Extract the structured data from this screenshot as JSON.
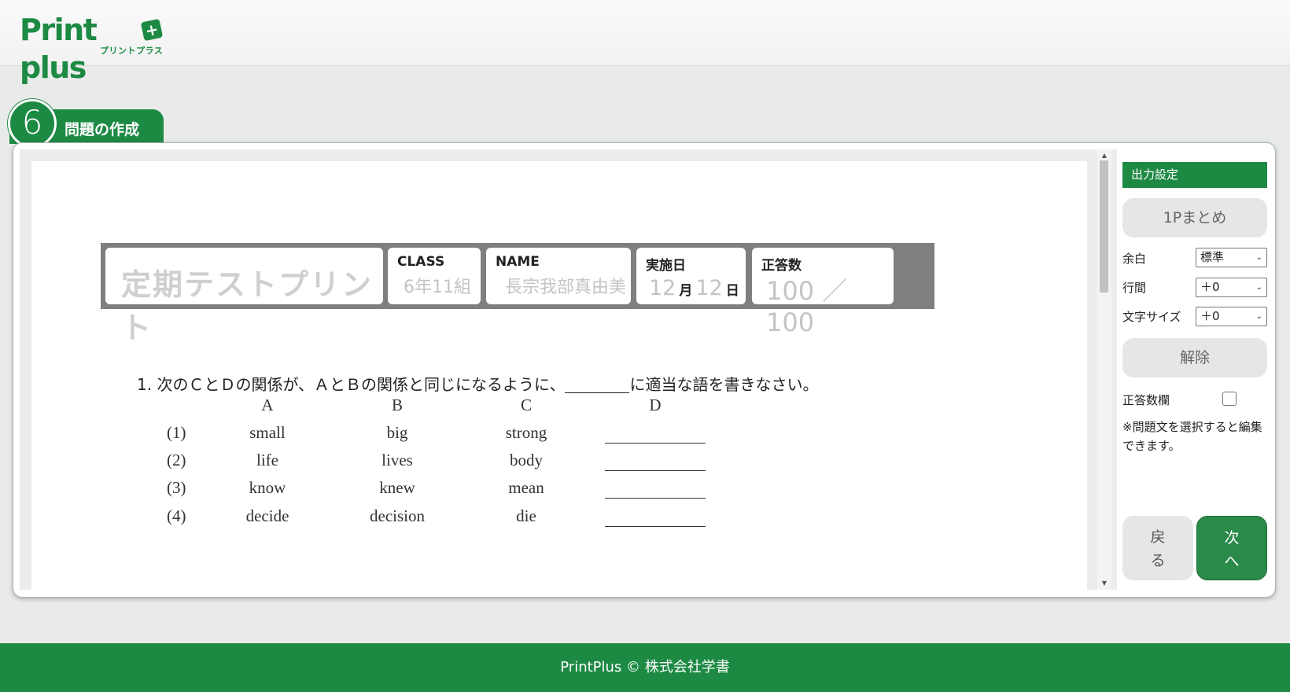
{
  "header": {
    "logo_text": "Print plus",
    "logo_sub": "プリントプラス",
    "logo_badge": "+"
  },
  "step": {
    "number": "6",
    "title": "問題の作成"
  },
  "sheet": {
    "title": "定期テストプリント",
    "class_label": "CLASS",
    "class_value": "6年11組",
    "name_label": "NAME",
    "name_value": "長宗我部真由美",
    "date_label": "実施日",
    "date_month": "12",
    "month_unit": "月",
    "date_day": "12",
    "day_unit": "日",
    "score_label": "正答数",
    "score_value": "100 ／ 100"
  },
  "question": {
    "heading_prefix": "1. 次のＣとＤの関係が、ＡとＢの関係と同じになるように、",
    "heading_suffix": "に適当な語を書きなさい。",
    "columns": [
      "A",
      "B",
      "C",
      "D"
    ],
    "rows": [
      {
        "num": "(1)",
        "a": "small",
        "b": "big",
        "c": "strong"
      },
      {
        "num": "(2)",
        "a": "life",
        "b": "lives",
        "c": "body"
      },
      {
        "num": "(3)",
        "a": "know",
        "b": "knew",
        "c": "mean"
      },
      {
        "num": "(4)",
        "a": "decide",
        "b": "decision",
        "c": "die"
      }
    ]
  },
  "settings": {
    "title": "出力設定",
    "summary_button": "1Pまとめ",
    "margin_label": "余白",
    "margin_value": "標準",
    "line_label": "行間",
    "line_value": "＋0",
    "font_label": "文字サイズ",
    "font_value": "＋0",
    "reset_button": "解除",
    "score_field_label": "正答数欄",
    "score_field_checked": false,
    "note": "※問題文を選択すると編集できます。",
    "back_button": "戻る",
    "next_button": "次へ"
  },
  "colors": {
    "brand_green": "#1d8a44",
    "button_gray": "#e6e6e6"
  },
  "footer": {
    "text": "PrintPlus © 株式会社学書"
  }
}
